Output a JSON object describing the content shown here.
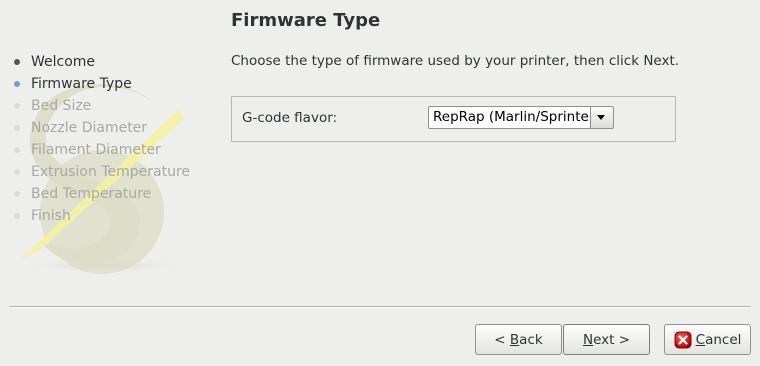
{
  "window": {
    "title": "Firmware Type"
  },
  "steps": [
    {
      "label": "Welcome",
      "state": "done"
    },
    {
      "label": "Firmware Type",
      "state": "current"
    },
    {
      "label": "Bed Size",
      "state": "todo"
    },
    {
      "label": "Nozzle Diameter",
      "state": "todo"
    },
    {
      "label": "Filament Diameter",
      "state": "todo"
    },
    {
      "label": "Extrusion Temperature",
      "state": "todo"
    },
    {
      "label": "Bed Temperature",
      "state": "todo"
    },
    {
      "label": "Finish",
      "state": "todo"
    }
  ],
  "page": {
    "instructions": "Choose the type of firmware used by your printer, then click Next.",
    "field_label": "G-code flavor:",
    "combo_value": "RepRap (Marlin/Sprinter)"
  },
  "buttons": {
    "back_mnemonic": "B",
    "back_rest": "ack",
    "back_prefix": "< ",
    "next_mnemonic": "N",
    "next_rest": "ext >",
    "cancel_mnemonic": "C",
    "cancel_rest": "ancel"
  },
  "icons": {
    "combo_arrow": "chevron-down-icon",
    "cancel": "cancel-icon",
    "logo": "slic3r-logo-icon"
  },
  "colors": {
    "background": "#eeeeec",
    "current_step_bullet": "#729fcf",
    "done_step_bullet": "#555753",
    "todo_step_text": "#a7a9a4",
    "cancel_icon": "#cc0000"
  }
}
